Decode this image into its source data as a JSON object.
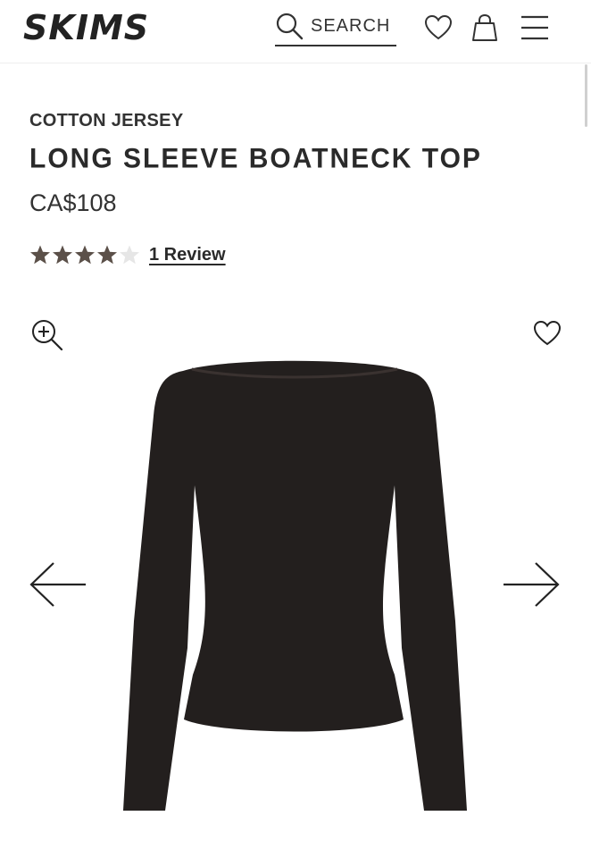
{
  "header": {
    "brand": "SKIMS",
    "search_label": "SEARCH",
    "icons": [
      "search-icon",
      "heart-icon",
      "bag-icon",
      "menu-icon"
    ]
  },
  "product": {
    "category": "COTTON JERSEY",
    "title": "LONG SLEEVE BOATNECK TOP",
    "price": "CA$108",
    "rating": 4,
    "rating_max": 5,
    "reviews_label": "1 Review"
  },
  "gallery": {
    "icons": [
      "zoom-in-icon",
      "heart-icon",
      "arrow-left-icon",
      "arrow-right-icon"
    ],
    "colors": {
      "garment": "#231f1e",
      "star_filled": "#5b5049",
      "star_empty": "#e6e6e6"
    }
  }
}
